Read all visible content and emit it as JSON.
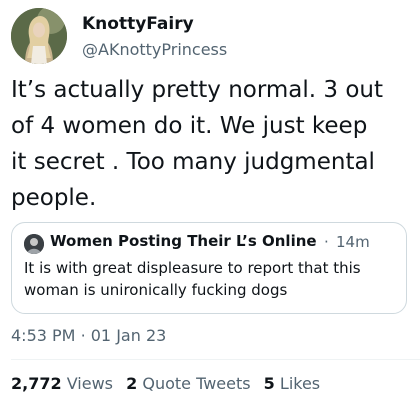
{
  "author": {
    "name": "KnottyFairy",
    "handle": "@AKnottyPrincess"
  },
  "tweet": {
    "lines": [
      "It’s actually pretty normal. 3 out",
      "of 4 women do it. We just keep",
      "it secret . Too many judgmental",
      "people."
    ]
  },
  "quote": {
    "author_name": "Women Posting Their L’s Online (...",
    "separator": "·",
    "time": "14m",
    "lines": [
      "It is with great displeasure to report that this",
      "woman is unironically fucking dogs"
    ]
  },
  "timestamp": {
    "time": "4:53 PM",
    "separator": "·",
    "date": "01 Jan 23"
  },
  "stats": {
    "views_count": "2,772",
    "views_label": "Views",
    "quotes_count": "2",
    "quotes_label": "Quote Tweets",
    "likes_count": "5",
    "likes_label": "Likes"
  },
  "colors": {
    "text_primary": "#0f1419",
    "text_secondary": "#536471",
    "border": "#cfd9de"
  }
}
